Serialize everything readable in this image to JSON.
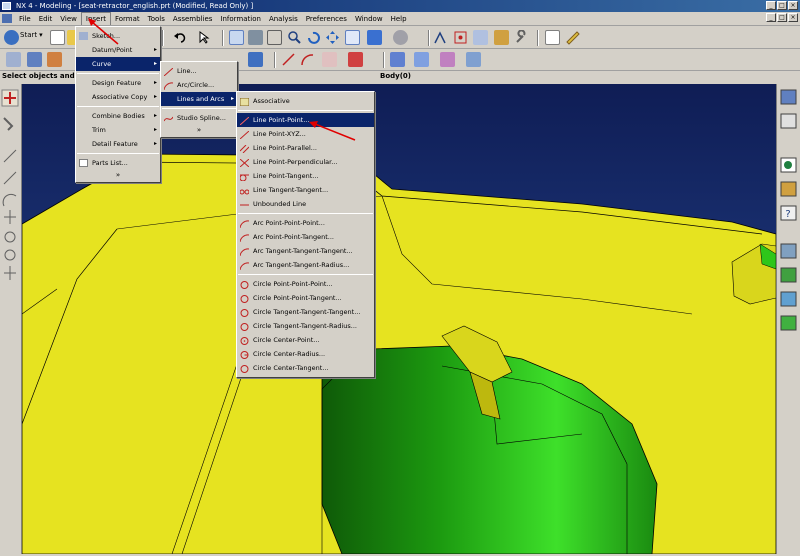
{
  "window": {
    "title": "NX 4 - Modeling - [seat-retractor_english.prt (Modified, Read Only) ]",
    "buttons": [
      "_",
      "□",
      "×"
    ]
  },
  "menubar": {
    "items": [
      "File",
      "Edit",
      "View",
      "Insert",
      "Format",
      "Tools",
      "Assemblies",
      "Information",
      "Analysis",
      "Preferences",
      "Window",
      "Help"
    ]
  },
  "toolbar": {
    "start_label": "Start"
  },
  "status": {
    "prompt": "Select objects and us",
    "selection": "Body(0)"
  },
  "insert_menu": {
    "items": [
      {
        "label": "Sketch...",
        "arrow": false
      },
      {
        "label": "Datum/Point",
        "arrow": true
      },
      {
        "label": "Curve",
        "arrow": true
      },
      {
        "label": "Design Feature",
        "arrow": true
      },
      {
        "label": "Associative Copy",
        "arrow": true
      },
      {
        "label": "Combine Bodies",
        "arrow": true
      },
      {
        "label": "Trim",
        "arrow": true
      },
      {
        "label": "Detail Feature",
        "arrow": true
      },
      {
        "label": "Parts List...",
        "arrow": false
      }
    ],
    "more": "»"
  },
  "curve_menu": {
    "items": [
      "Line...",
      "Arc/Circle...",
      "Lines and Arcs",
      "Studio Spline..."
    ],
    "more": "»"
  },
  "lines_arcs_menu": {
    "associative": "Associative",
    "lines": [
      "Line Point-Point...",
      "Line Point-XYZ...",
      "Line Point-Parallel...",
      "Line Point-Perpendicular...",
      "Line Point-Tangent...",
      "Line Tangent-Tangent...",
      "Unbounded Line"
    ],
    "arcs": [
      "Arc Point-Point-Point...",
      "Arc Point-Point-Tangent...",
      "Arc Tangent-Tangent-Tangent...",
      "Arc Tangent-Tangent-Radius..."
    ],
    "circles": [
      "Circle Point-Point-Point...",
      "Circle Point-Point-Tangent...",
      "Circle Tangent-Tangent-Tangent...",
      "Circle Tangent-Tangent-Radius...",
      "Circle Center-Point...",
      "Circle Center-Radius...",
      "Circle Center-Tangent..."
    ]
  },
  "colors": {
    "viewport_bg": "#1a2d66",
    "yellow_body": "#e6e320",
    "green_body": "#2ec61a",
    "highlight": "#0a246a",
    "annotation": "#e00000"
  }
}
